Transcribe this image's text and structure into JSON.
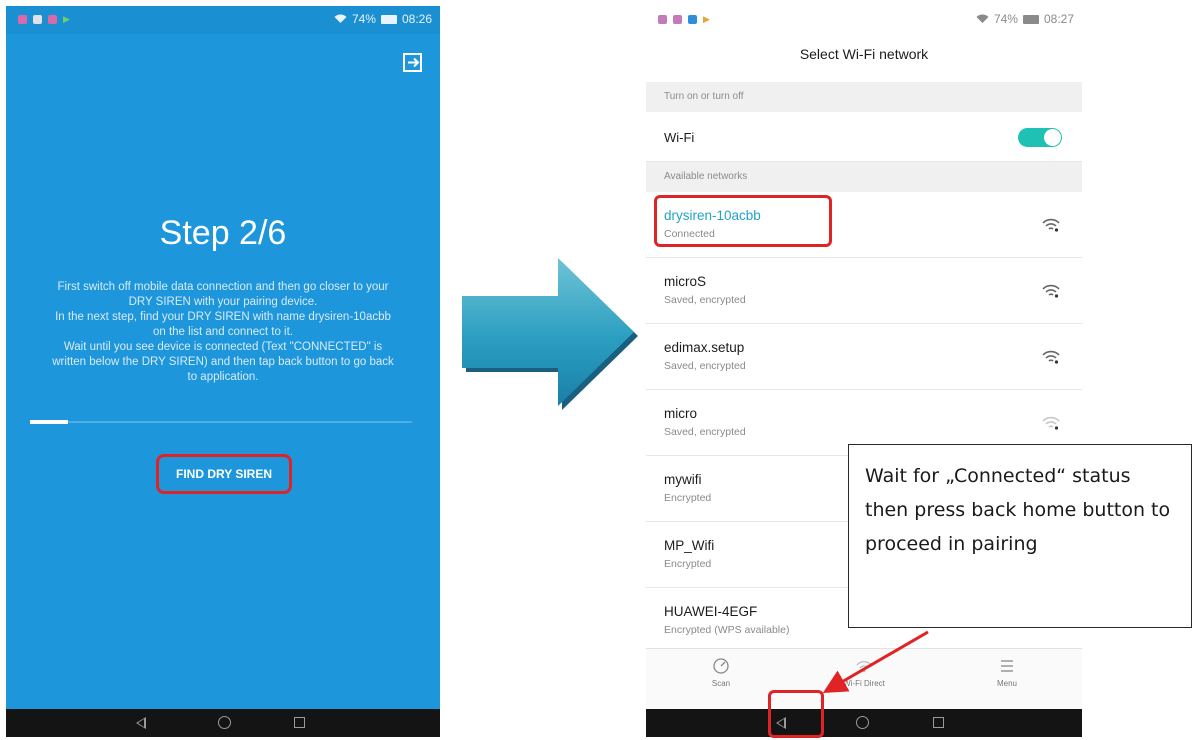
{
  "left_screen": {
    "status_time": "08:26",
    "status_battery": "74%",
    "step_title": "Step 2/6",
    "description_lines": [
      "First switch off mobile data connection and then go closer to your",
      "DRY SIREN with your pairing device.",
      "In the next step, find your DRY SIREN with name drysiren-10acbb",
      "on the list and connect to it.",
      "Wait until you see device is connected (Text \"CONNECTED\" is",
      "written below the DRY SIREN) and then tap back button to go back",
      "to application."
    ],
    "progress": 0.1,
    "find_button_label": "FIND DRY SIREN",
    "exit_icon": "exit-to-app-icon"
  },
  "right_screen": {
    "status_time": "08:27",
    "status_battery": "74%",
    "title": "Select Wi-Fi network",
    "section_toggle": "Turn on or turn off",
    "wifi_label": "Wi-Fi",
    "wifi_enabled": true,
    "section_available": "Available networks",
    "networks": [
      {
        "name": "drysiren-10acbb",
        "status": "Connected",
        "signal": "strong"
      },
      {
        "name": "microS",
        "status": "Saved, encrypted",
        "signal": "strong"
      },
      {
        "name": "edimax.setup",
        "status": "Saved, encrypted",
        "signal": "strong"
      },
      {
        "name": "micro",
        "status": "Saved, encrypted",
        "signal": "weak"
      },
      {
        "name": "mywifi",
        "status": "Encrypted",
        "signal": "strong"
      },
      {
        "name": "MP_Wifi",
        "status": "Encrypted",
        "signal": "strong"
      },
      {
        "name": "HUAWEI-4EGF",
        "status": "Encrypted (WPS available)",
        "signal": "strong"
      }
    ],
    "actions": [
      {
        "label": "Scan",
        "icon": "scan-icon"
      },
      {
        "label": "Wi-Fi Direct",
        "icon": "wifi-direct-icon"
      },
      {
        "label": "Menu",
        "icon": "menu-icon"
      }
    ]
  },
  "callout": {
    "text": "Wait for „Connected“ status then press back home button to proceed in pairing"
  },
  "colors": {
    "app_blue": "#1d96db",
    "highlight_red": "#e02325",
    "toggle_teal": "#1fc1b4",
    "connected_text": "#22a3c7"
  }
}
